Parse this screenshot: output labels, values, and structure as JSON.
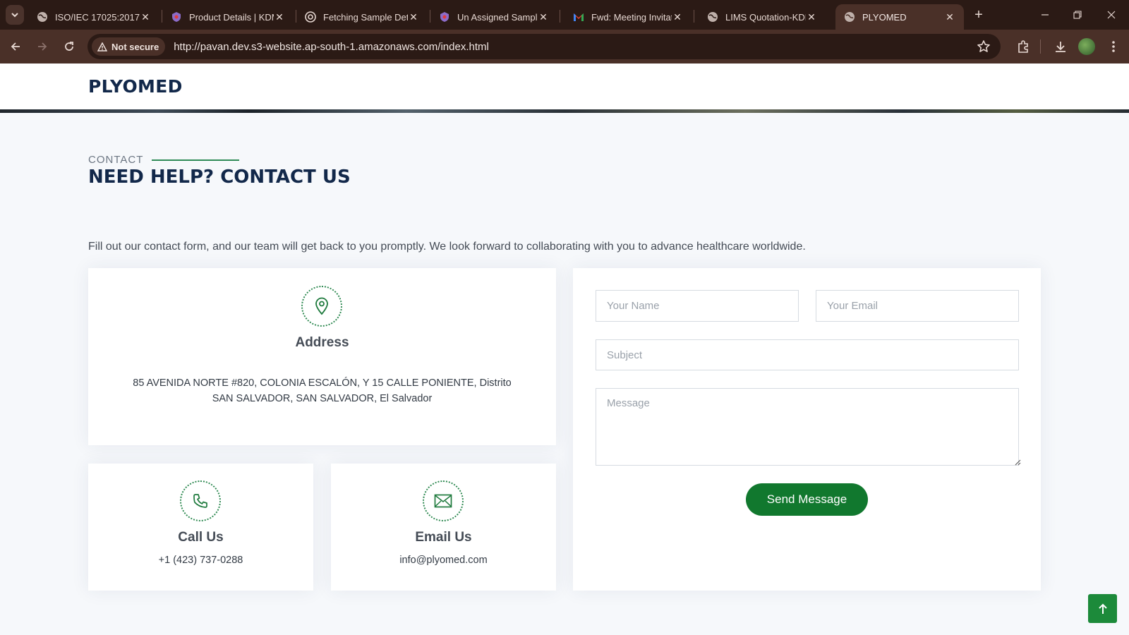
{
  "browser": {
    "tabs": [
      {
        "title": "ISO/IEC 17025:2017",
        "favicon": "globe-icon"
      },
      {
        "title": "Product Details | KDM",
        "favicon": "shield-icon"
      },
      {
        "title": "Fetching Sample Det",
        "favicon": "openai-icon"
      },
      {
        "title": "Un Assigned Sample",
        "favicon": "shield-icon"
      },
      {
        "title": "Fwd: Meeting Invitati",
        "favicon": "gmail-icon"
      },
      {
        "title": "LIMS Quotation-KDM",
        "favicon": "globe-icon"
      },
      {
        "title": "PLYOMED",
        "favicon": "globe-icon",
        "active": true
      }
    ],
    "security_label": "Not secure",
    "url": "http://pavan.dev.s3-website.ap-south-1.amazonaws.com/index.html"
  },
  "site": {
    "logo": "PLYOMED"
  },
  "contact": {
    "eyebrow": "CONTACT",
    "title": "NEED HELP? CONTACT US",
    "intro": "Fill out our contact form, and our team will get back to you promptly. We look forward to collaborating with you to advance healthcare worldwide.",
    "address": {
      "title": "Address",
      "text": "85 AVENIDA NORTE #820, COLONIA ESCALÓN, Y 15 CALLE PONIENTE, Distrito SAN SALVADOR, SAN SALVADOR, El Salvador",
      "icon": "map-pin-icon"
    },
    "call": {
      "title": "Call Us",
      "text": "+1 (423) 737-0288",
      "icon": "phone-icon"
    },
    "email": {
      "title": "Email Us",
      "text": "info@plyomed.com",
      "icon": "envelope-icon"
    },
    "form": {
      "name_placeholder": "Your Name",
      "email_placeholder": "Your Email",
      "subject_placeholder": "Subject",
      "message_placeholder": "Message",
      "submit_label": "Send Message"
    }
  },
  "colors": {
    "brand_navy": "#12284a",
    "accent_green": "#11782e",
    "chrome_dark": "#2b1a15",
    "chrome_toolbar": "#4a3028"
  }
}
